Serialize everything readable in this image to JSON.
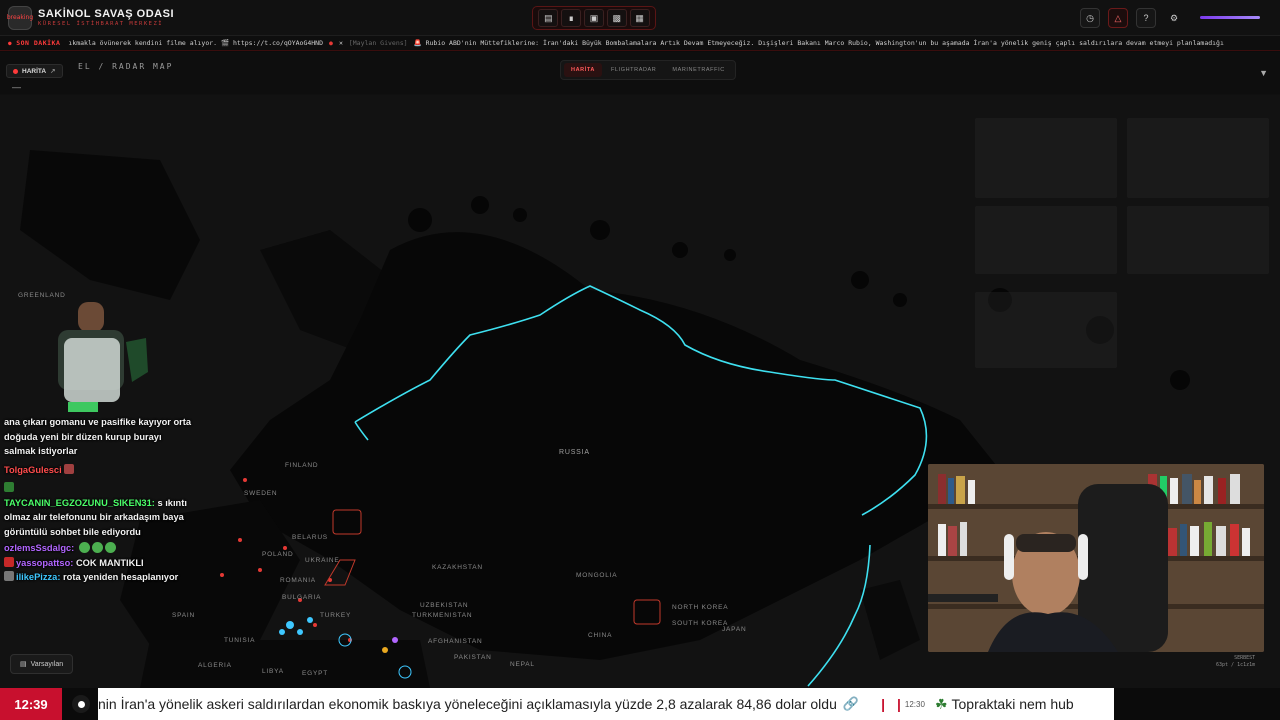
{
  "header": {
    "logo_text": "breaking",
    "title": "SAKİNOL SAVAŞ ODASI",
    "subtitle": "KÜRESEL İSTİHBARAT MERKEZİ",
    "center_tools": [
      "map-icon",
      "rss-icon",
      "tv-icon",
      "chart-icon",
      "news-icon"
    ],
    "right_tools": [
      "clock-icon",
      "alert-icon",
      "help-icon",
      "gear-icon"
    ]
  },
  "ticker_top": {
    "label": "SON DAKİKA",
    "item1": "ıkmakla övünerek kendini filme alıyor. 🎬 https://t.co/qOYAoG4HND",
    "source": "[Maylan Givens]",
    "item2": "🚨 Rubio ABD'nin Müttefiklerine: İran'daki Büyük Bombalamalara Artık Devam Etmeyeceğiz. Dışişleri Bakanı Marco Rubio, Washington'un bu aşamada İran'a yönelik geniş çaplı saldırılara devam etmeyi planlamadığı"
  },
  "map": {
    "panel_button": "HARİTA",
    "radar_title": "EL / RADAR MAP",
    "tabs": [
      {
        "label": "HARİTA",
        "active": true
      },
      {
        "label": "FLIGHTRADAR",
        "active": false
      },
      {
        "label": "MARINETRAFFIC",
        "active": false
      }
    ],
    "countries": [
      "RUSSIA",
      "KAZAKHSTAN",
      "MONGOLIA",
      "CHINA",
      "UZBEKISTAN",
      "TURKMENISTAN",
      "AFGHANISTAN",
      "PAKISTAN",
      "NEPAL",
      "TURKEY",
      "UKRAINE",
      "BELARUS",
      "POLAND",
      "ROMANIA",
      "BULGARIA",
      "FINLAND",
      "SWEDEN",
      "SPAIN",
      "TUNISIA",
      "ALGERIA",
      "LIBYA",
      "EGYPT",
      "NORTH KOREA",
      "SOUTH KOREA",
      "JAPAN",
      "GREENLAND"
    ],
    "route_color": "#3ee0f0",
    "defaults_button": "Varsayılan",
    "fps_line1": "SERBEST",
    "fps_line2": "63pt / 1c1z1m"
  },
  "chat": [
    {
      "user": "",
      "user_color": "#ffffff",
      "text": "ana çıkarı gomanu ve pasifike kayıyor orta doğuda yeni bir düzen kurup burayı salmak istiyorlar"
    },
    {
      "user": "TolgaGulesci",
      "user_color": "#ff4d4d",
      "text": ""
    },
    {
      "user": "TAYCANIN_EGZOZUNU_SIKEN31",
      "user_color": "#4cff6a",
      "text": "s ıkıntı olmaz alır telefonunu bir arkadaşım baya görüntülü sohbet bile ediyordu"
    },
    {
      "user": "ozlemsSsdalgc",
      "user_color": "#b266ff",
      "text": ""
    },
    {
      "user": "yassopattso",
      "user_color": "#b266ff",
      "text": "COK MANTIKLI"
    },
    {
      "user": "ilikePizza",
      "user_color": "#3ec8ff",
      "text": "rota yeniden hesaplanıyor"
    }
  ],
  "bottom_ticker": {
    "clock": "12:39",
    "headline": "nin İran'a yönelik askeri saldırılardan ekonomik baskıya yöneleceğini açıklamasıyla yüzde 2,8 azalarak 84,86 dolar oldu",
    "next_time": "12:30",
    "next_headline": "Topraktaki nem hub"
  }
}
